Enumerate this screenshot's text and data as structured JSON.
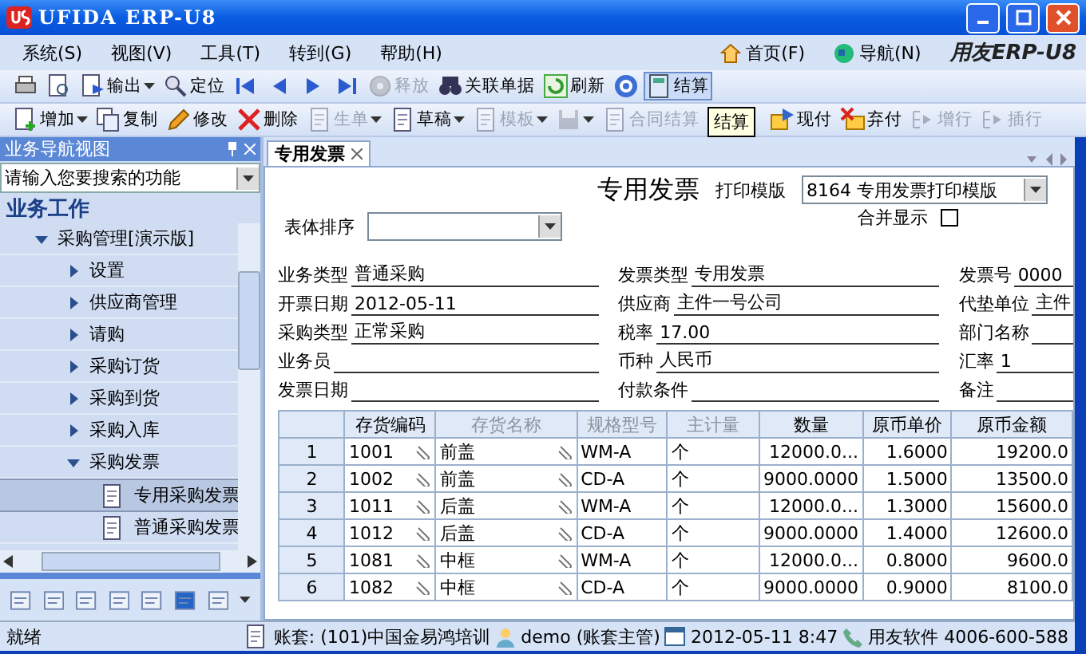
{
  "window": {
    "title": "UFIDA ERP-U8"
  },
  "menu": [
    "系统(S)",
    "视图(V)",
    "工具(T)",
    "转到(G)",
    "帮助(H)"
  ],
  "nav_links": [
    "首页(F)",
    "导航(N)"
  ],
  "logo": "用友ERP-U8",
  "toolbar_1": [
    {
      "disabled": false,
      "highlighted": false,
      "dropdown": false
    },
    {
      "disabled": false,
      "highlighted": false,
      "dropdown": false
    },
    {
      "label": "输出",
      "disabled": false,
      "highlighted": false,
      "dropdown": true
    },
    {
      "label": "定位",
      "disabled": false,
      "highlighted": false,
      "dropdown": false
    },
    {
      "disabled": false,
      "highlighted": false,
      "dropdown": false
    },
    {
      "disabled": false,
      "highlighted": false,
      "dropdown": false
    },
    {
      "disabled": false,
      "highlighted": false,
      "dropdown": false
    },
    {
      "disabled": false,
      "highlighted": false,
      "dropdown": false
    },
    {
      "label": "释放",
      "disabled": true,
      "highlighted": false,
      "dropdown": false
    },
    {
      "label": "关联单据",
      "disabled": false,
      "highlighted": false,
      "dropdown": false
    },
    {
      "label": "刷新",
      "disabled": false,
      "highlighted": false,
      "dropdown": false
    },
    {
      "disabled": false,
      "highlighted": false,
      "dropdown": false
    },
    {
      "label": "结算",
      "disabled": false,
      "highlighted": true,
      "dropdown": false
    }
  ],
  "toolbar_2": [
    {
      "label": "增加",
      "disabled": false,
      "dropdown": true
    },
    {
      "label": "复制",
      "disabled": false,
      "dropdown": false
    },
    {
      "label": "修改",
      "disabled": false,
      "dropdown": false
    },
    {
      "label": "删除",
      "disabled": false,
      "dropdown": false
    },
    {
      "label": "生单",
      "disabled": true,
      "dropdown": true
    },
    {
      "label": "草稿",
      "disabled": false,
      "dropdown": true
    },
    {
      "label": "模板",
      "disabled": true,
      "dropdown": true
    },
    {
      "disabled": true,
      "dropdown": true
    },
    {
      "label": "合同结算",
      "disabled": true,
      "dropdown": false
    },
    {
      "dropdown": false,
      "tooltip": "结算"
    },
    {
      "label": "现付",
      "disabled": false,
      "dropdown": false
    },
    {
      "label": "弃付",
      "disabled": false,
      "dropdown": false
    },
    {
      "label": "增行",
      "disabled": true,
      "dropdown": false
    },
    {
      "label": "插行",
      "disabled": true,
      "dropdown": false
    }
  ],
  "nav_panel": {
    "title": "业务导航视图",
    "placeholder": "请输入您要搜索的功能",
    "heading": "业务工作",
    "tree": [
      {
        "label": "采购管理[演示版]",
        "kind": "folder",
        "expanded": true,
        "selected": false,
        "children": [
          {
            "label": "设置",
            "kind": "folder",
            "expanded": false,
            "selected": false
          },
          {
            "label": "供应商管理",
            "kind": "folder",
            "expanded": false,
            "selected": false
          },
          {
            "label": "请购",
            "kind": "folder",
            "expanded": false,
            "selected": false
          },
          {
            "label": "采购订货",
            "kind": "folder",
            "expanded": false,
            "selected": false
          },
          {
            "label": "采购到货",
            "kind": "folder",
            "expanded": false,
            "selected": false
          },
          {
            "label": "采购入库",
            "kind": "folder",
            "expanded": false,
            "selected": false
          },
          {
            "label": "采购发票",
            "kind": "folder",
            "expanded": true,
            "selected": false,
            "children": [
              {
                "label": "专用采购发票",
                "kind": "leaf",
                "selected": true
              },
              {
                "label": "普通采购发票",
                "kind": "leaf",
                "selected": false
              }
            ]
          }
        ]
      }
    ]
  },
  "tabs": [
    {
      "label": "专用发票",
      "selected": true
    }
  ],
  "invoice": {
    "title": "专用发票",
    "print_template_label": "打印模版",
    "print_template": "8164 专用发票打印模版",
    "sort_label": "表体排序",
    "merge_label": "合并显示",
    "merge_checked": false,
    "field_columns": [
      [
        {
          "label": "业务类型",
          "value": "普通采购"
        },
        {
          "label": "开票日期",
          "value": "2012-05-11"
        },
        {
          "label": "采购类型",
          "value": "正常采购"
        },
        {
          "label": "业务员"
        },
        {
          "label": "发票日期"
        }
      ],
      [
        {
          "label": "发票类型",
          "value": "专用发票"
        },
        {
          "label": "供应商",
          "value": "主件一号公司"
        },
        {
          "label": "税率",
          "value": "17.00"
        },
        {
          "label": "币种",
          "value": "人民币"
        },
        {
          "label": "付款条件"
        }
      ],
      [
        {
          "label": "发票号",
          "value": "0000"
        },
        {
          "label": "代垫单位",
          "value": "主件"
        },
        {
          "label": "部门名称"
        },
        {
          "label": "汇率",
          "value": "1"
        },
        {
          "label": "备注"
        }
      ]
    ]
  },
  "table": {
    "columns": [
      {
        "label": "存货编码",
        "kind": "lookup",
        "disabled": false
      },
      {
        "label": "存货名称",
        "kind": "lookup",
        "disabled": true
      },
      {
        "label": "规格型号",
        "kind": "text",
        "disabled": true
      },
      {
        "label": "主计量",
        "kind": "text",
        "disabled": true
      },
      {
        "label": "数量",
        "kind": "number",
        "disabled": false
      },
      {
        "label": "原币单价",
        "kind": "number",
        "disabled": false
      },
      {
        "label": "原币金额",
        "kind": "number",
        "disabled": false
      }
    ],
    "rows": [
      {
        "number": "1",
        "cells": [
          "1001",
          "前盖",
          "WM-A",
          "个",
          "12000.0...",
          "1.6000",
          "19200.0"
        ]
      },
      {
        "number": "2",
        "cells": [
          "1002",
          "前盖",
          "CD-A",
          "个",
          "9000.0000",
          "1.5000",
          "13500.0"
        ]
      },
      {
        "number": "3",
        "cells": [
          "1011",
          "后盖",
          "WM-A",
          "个",
          "12000.0...",
          "1.3000",
          "15600.0"
        ]
      },
      {
        "number": "4",
        "cells": [
          "1012",
          "后盖",
          "CD-A",
          "个",
          "9000.0000",
          "1.4000",
          "12600.0"
        ]
      },
      {
        "number": "5",
        "cells": [
          "1081",
          "中框",
          "WM-A",
          "个",
          "12000.0...",
          "0.8000",
          "9600.0"
        ]
      },
      {
        "number": "6",
        "cells": [
          "1082",
          "中框",
          "CD-A",
          "个",
          "9000.0000",
          "0.9000",
          "8100.0"
        ]
      }
    ]
  },
  "status_bar": {
    "message": "就绪",
    "account": "账套: (101)中国金易鸿培训",
    "user": "demo (账套主管)",
    "date": "2012-05-11  8:47",
    "vendor": "用友软件 4006-600-588"
  }
}
